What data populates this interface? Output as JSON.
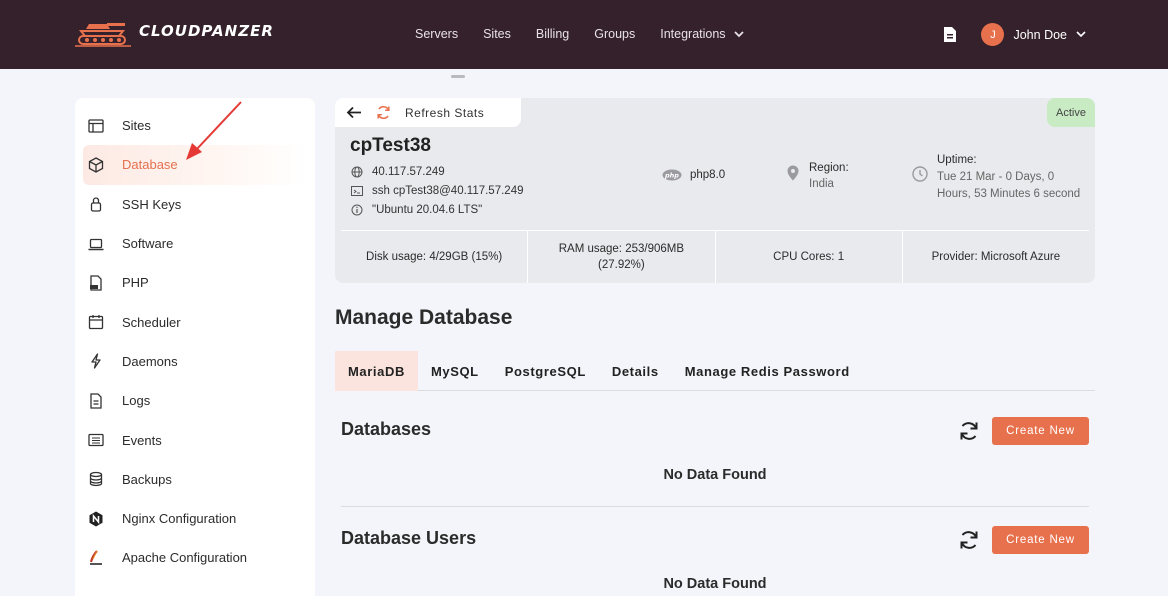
{
  "app": {
    "brand": "CLOUDPANZER"
  },
  "nav": {
    "items": [
      "Servers",
      "Sites",
      "Billing",
      "Groups",
      "Integrations"
    ]
  },
  "user": {
    "initial": "J",
    "name": "John Doe"
  },
  "sidebar": {
    "items": [
      {
        "label": "Sites",
        "icon": "sites-icon"
      },
      {
        "label": "Database",
        "icon": "database-box-icon",
        "active": true
      },
      {
        "label": "SSH Keys",
        "icon": "lock-icon"
      },
      {
        "label": "Software",
        "icon": "laptop-icon"
      },
      {
        "label": "PHP",
        "icon": "php-file-icon"
      },
      {
        "label": "Scheduler",
        "icon": "calendar-icon"
      },
      {
        "label": "Daemons",
        "icon": "bolt-icon"
      },
      {
        "label": "Logs",
        "icon": "file-icon"
      },
      {
        "label": "Events",
        "icon": "list-icon"
      },
      {
        "label": "Backups",
        "icon": "stack-icon"
      },
      {
        "label": "Nginx Configuration",
        "icon": "nginx-icon"
      },
      {
        "label": "Apache Configuration",
        "icon": "apache-icon"
      }
    ]
  },
  "server": {
    "refresh_label": "Refresh Stats",
    "status": "Active",
    "name": "cpTest38",
    "ip": "40.117.57.249",
    "ssh": "ssh cpTest38@40.117.57.249",
    "os": "\"Ubuntu 20.04.6 LTS\"",
    "php": "php8.0",
    "region_label": "Region:",
    "region_value": "India",
    "uptime_label": "Uptime:",
    "uptime_line1": "Tue 21 Mar - 0 Days, 0",
    "uptime_line2": "Hours, 53 Minutes 6 second",
    "disk_label": "Disk usage:",
    "disk_value": " 4/29GB (15%)",
    "ram_label": "RAM usage:",
    "ram_value": " 253/906MB",
    "ram_pct": "(27.92%)",
    "cpu_label": "CPU Cores:",
    "cpu_value": " 1",
    "provider_label": "Provider:",
    "provider_value": " Microsoft Azure"
  },
  "main": {
    "title": "Manage Database",
    "tabs": [
      "MariaDB",
      "MySQL",
      "PostgreSQL",
      "Details",
      "Manage Redis Password"
    ],
    "databases_title": "Databases",
    "users_title": "Database Users",
    "create_label": "Create New",
    "empty_text": "No Data Found"
  },
  "colors": {
    "accent": "#e8714d",
    "topbar": "#34212c",
    "active_badge": "#c8ebc4"
  }
}
